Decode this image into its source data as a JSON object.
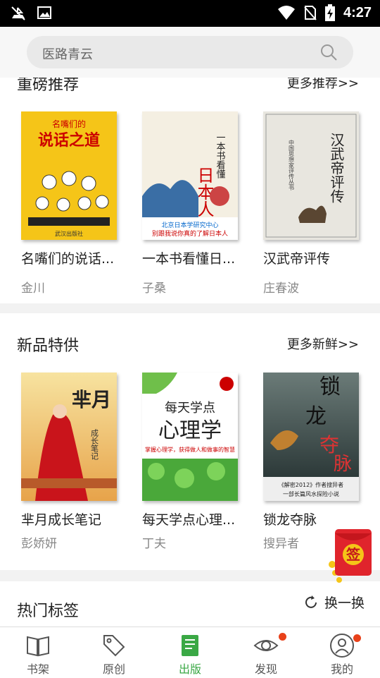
{
  "status_bar": {
    "time": "4:27"
  },
  "search": {
    "placeholder": "医路青云"
  },
  "sections": {
    "recommend": {
      "title": "重磅推荐",
      "more": "更多推荐>>",
      "books": [
        {
          "title": "名嘴们的说话...",
          "author": "金川",
          "cover_text": "名嘴们的说话之道"
        },
        {
          "title": "一本书看懂日...",
          "author": "子桑",
          "cover_text": "一本书看懂日本人"
        },
        {
          "title": "汉武帝评传",
          "author": "庄春波",
          "cover_text": "汉武帝评传"
        }
      ]
    },
    "new": {
      "title": "新品特供",
      "more": "更多新鲜>>",
      "books": [
        {
          "title": "芈月成长笔记",
          "author": "彭娇妍",
          "cover_text": "芈月成长笔记"
        },
        {
          "title": "每天学点心理...",
          "author": "丁夫",
          "cover_text": "每天学点心理学"
        },
        {
          "title": "锁龙夺脉",
          "author": "搜异者",
          "cover_text": "锁龙夺脉"
        }
      ]
    },
    "hot_tags": {
      "title": "热门标签",
      "refresh": "换一换"
    }
  },
  "red_packet": {
    "label": "签"
  },
  "tabbar": {
    "tabs": [
      {
        "label": "书架",
        "icon": "book-open-icon",
        "active": false
      },
      {
        "label": "原创",
        "icon": "tag-icon",
        "active": false
      },
      {
        "label": "出版",
        "icon": "book-stack-icon",
        "active": true
      },
      {
        "label": "发现",
        "icon": "eye-icon",
        "active": false,
        "badge": true
      },
      {
        "label": "我的",
        "icon": "user-icon",
        "active": false,
        "badge": true
      }
    ]
  },
  "colors": {
    "accent": "#3aa845",
    "badge": "#e8411a",
    "cover_yellow": "#f5c518",
    "red_packet": "#e0242c"
  }
}
